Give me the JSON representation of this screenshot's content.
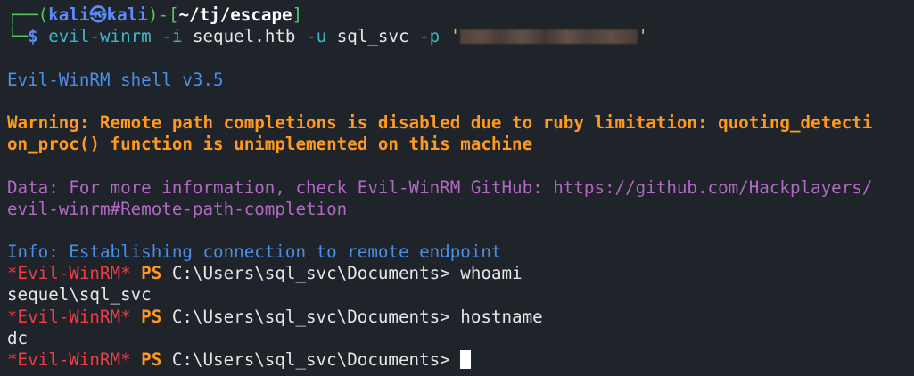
{
  "prompt": {
    "box_top_left": "┌──(",
    "user": "kali",
    "at_symbol": "㉿",
    "host": "kali",
    "separator": ")-[",
    "cwd": "~/tj/escape",
    "close_bracket": "]",
    "box_bottom_left": "└─",
    "dollar": "$ "
  },
  "command": {
    "program": "evil-winrm",
    "flag_i": " -i",
    "host_arg": " sequel.htb",
    "flag_u": " -u",
    "user_arg": " sql_svc",
    "flag_p": " -p",
    "quote_open": " '",
    "quote_close": "'"
  },
  "output": {
    "version": "Evil-WinRM shell v3.5",
    "warning_line1": "Warning: Remote path completions is disabled due to ruby limitation: quoting_detecti",
    "warning_line2": "on_proc() function is unimplemented on this machine",
    "data_line1": "Data: For more information, check Evil-WinRM GitHub: https://github.com/Hackplayers/",
    "data_line2": "evil-winrm#Remote-path-completion",
    "info": "Info: Establishing connection to remote endpoint"
  },
  "session": {
    "marker": "*Evil-WinRM*",
    "ps": " PS",
    "path": " C:\\Users\\sql_svc\\Documents> ",
    "cmd1": "whoami",
    "out1": "sequel\\sql_svc",
    "cmd2": "hostname",
    "out2": "dc"
  },
  "colors": {
    "background": "#1f232a",
    "prompt_green": "#53c85f",
    "user_blue": "#5b8cff",
    "info_blue": "#4a8fe7",
    "warning_orange": "#ff9a1f",
    "data_purple": "#b169c2",
    "marker_red": "#f03d43"
  }
}
